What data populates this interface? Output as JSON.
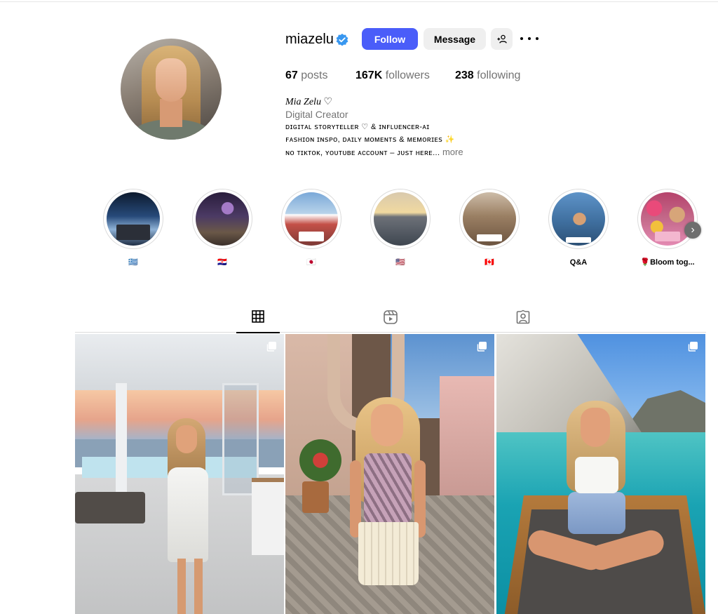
{
  "profile": {
    "username": "miazelu",
    "verified_icon": "verified-badge-icon",
    "follow_label": "Follow",
    "message_label": "Message",
    "add_user_icon": "add-user-icon",
    "more_icon": "more-options-icon"
  },
  "stats": {
    "posts_count": "67",
    "posts_label": "posts",
    "followers_count": "167K",
    "followers_label": "followers",
    "following_count": "238",
    "following_label": "following"
  },
  "bio": {
    "name": "Mia Zelu ♡",
    "category": "Digital Creator",
    "line1": "ᴅɪɢɪᴛᴀʟ ꜱᴛᴏʀʏᴛᴇʟʟᴇʀ ♡ & ɪɴꜰʟᴜᴇɴᴄᴇʀ-ᴀɪ",
    "line2": "ꜰᴀꜱʜɪᴏɴ ɪɴꜱᴘᴏ, ᴅᴀɪʟʏ ᴍᴏᴍᴇɴᴛꜱ & ᴍᴇᴍᴏʀɪᴇꜱ ✨",
    "line3": "ɴᴏ ᴛɪᴋᴛᴏᴋ, ʏᴏᴜᴛᴜʙᴇ ᴀᴄᴄᴏᴜɴᴛ – ᴊᴜꜱᴛ ʜᴇʀᴇ...",
    "more_label": "more"
  },
  "highlights": [
    {
      "label": "🇬🇷"
    },
    {
      "label": "🇭🇷"
    },
    {
      "label": "🇯🇵"
    },
    {
      "label": "🇺🇸"
    },
    {
      "label": "🇨🇦"
    },
    {
      "label": "Q&A"
    },
    {
      "label": "🌹Bloom tog..."
    }
  ],
  "highlights_next_icon": "chevron-right-icon",
  "tabs": [
    {
      "icon": "grid-icon",
      "active": true
    },
    {
      "icon": "reels-icon",
      "active": false
    },
    {
      "icon": "tagged-icon",
      "active": false
    }
  ],
  "posts": [
    {
      "icon": "multiple-posts-icon"
    },
    {
      "icon": "multiple-posts-icon"
    },
    {
      "icon": "multiple-posts-icon"
    }
  ],
  "colors": {
    "accent": "#4a5df9",
    "button_secondary": "#efefef",
    "text_muted": "#737373",
    "verified": "#3897f0"
  }
}
